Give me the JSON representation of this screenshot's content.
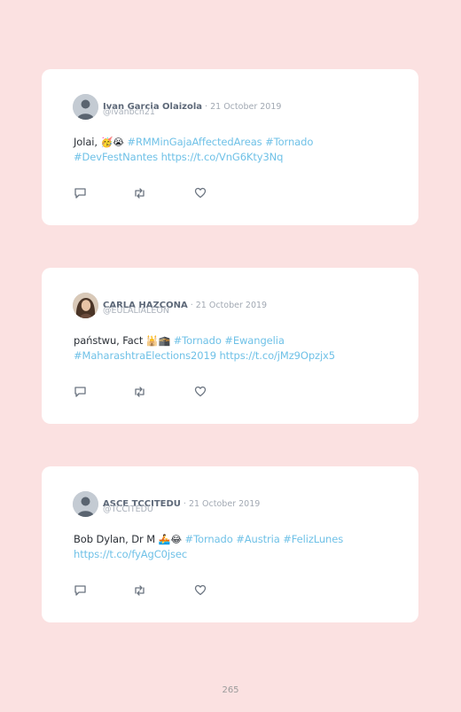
{
  "tweets": [
    {
      "name": "Ivan Garcia Olaizola",
      "date": "21 October 2019",
      "handle": "@ivanbcn21",
      "text_plain": "Jolai, ",
      "emojis": "🥳😭",
      "links": "#RMMinGajaAffectedAreas #Tornado #DevFestNantes https://t.co/VnG6Kty3Nq",
      "avatar": "default-user-icon"
    },
    {
      "name": "CARLA HAZCONA",
      "date": "21 October 2019",
      "handle": "@EULALIALEON",
      "text_plain": "państwu, Fact ",
      "emojis": "🕌🕋",
      "links": "#Tornado #Ewangelia #MaharashtraElections2019 https://t.co/jMz9Opzjx5",
      "avatar": "photo-avatar"
    },
    {
      "name": "ASCE TCCITEDU",
      "date": "21 October 2019",
      "handle": "@TCCITEDU",
      "text_plain": "Bob Dylan, Dr M ",
      "emojis": "🚣😂",
      "links": "#Tornado #Austria #FelizLunes https://t.co/fyAgC0jsec",
      "avatar": "default-user-icon"
    }
  ],
  "icons": {
    "reply": "reply-icon",
    "retweet": "retweet-icon",
    "like": "heart-icon"
  },
  "colors": {
    "background": "#fbe1e1",
    "card": "#ffffff",
    "link": "#6fc1e7",
    "name": "#5d6878"
  },
  "page_number": "265"
}
